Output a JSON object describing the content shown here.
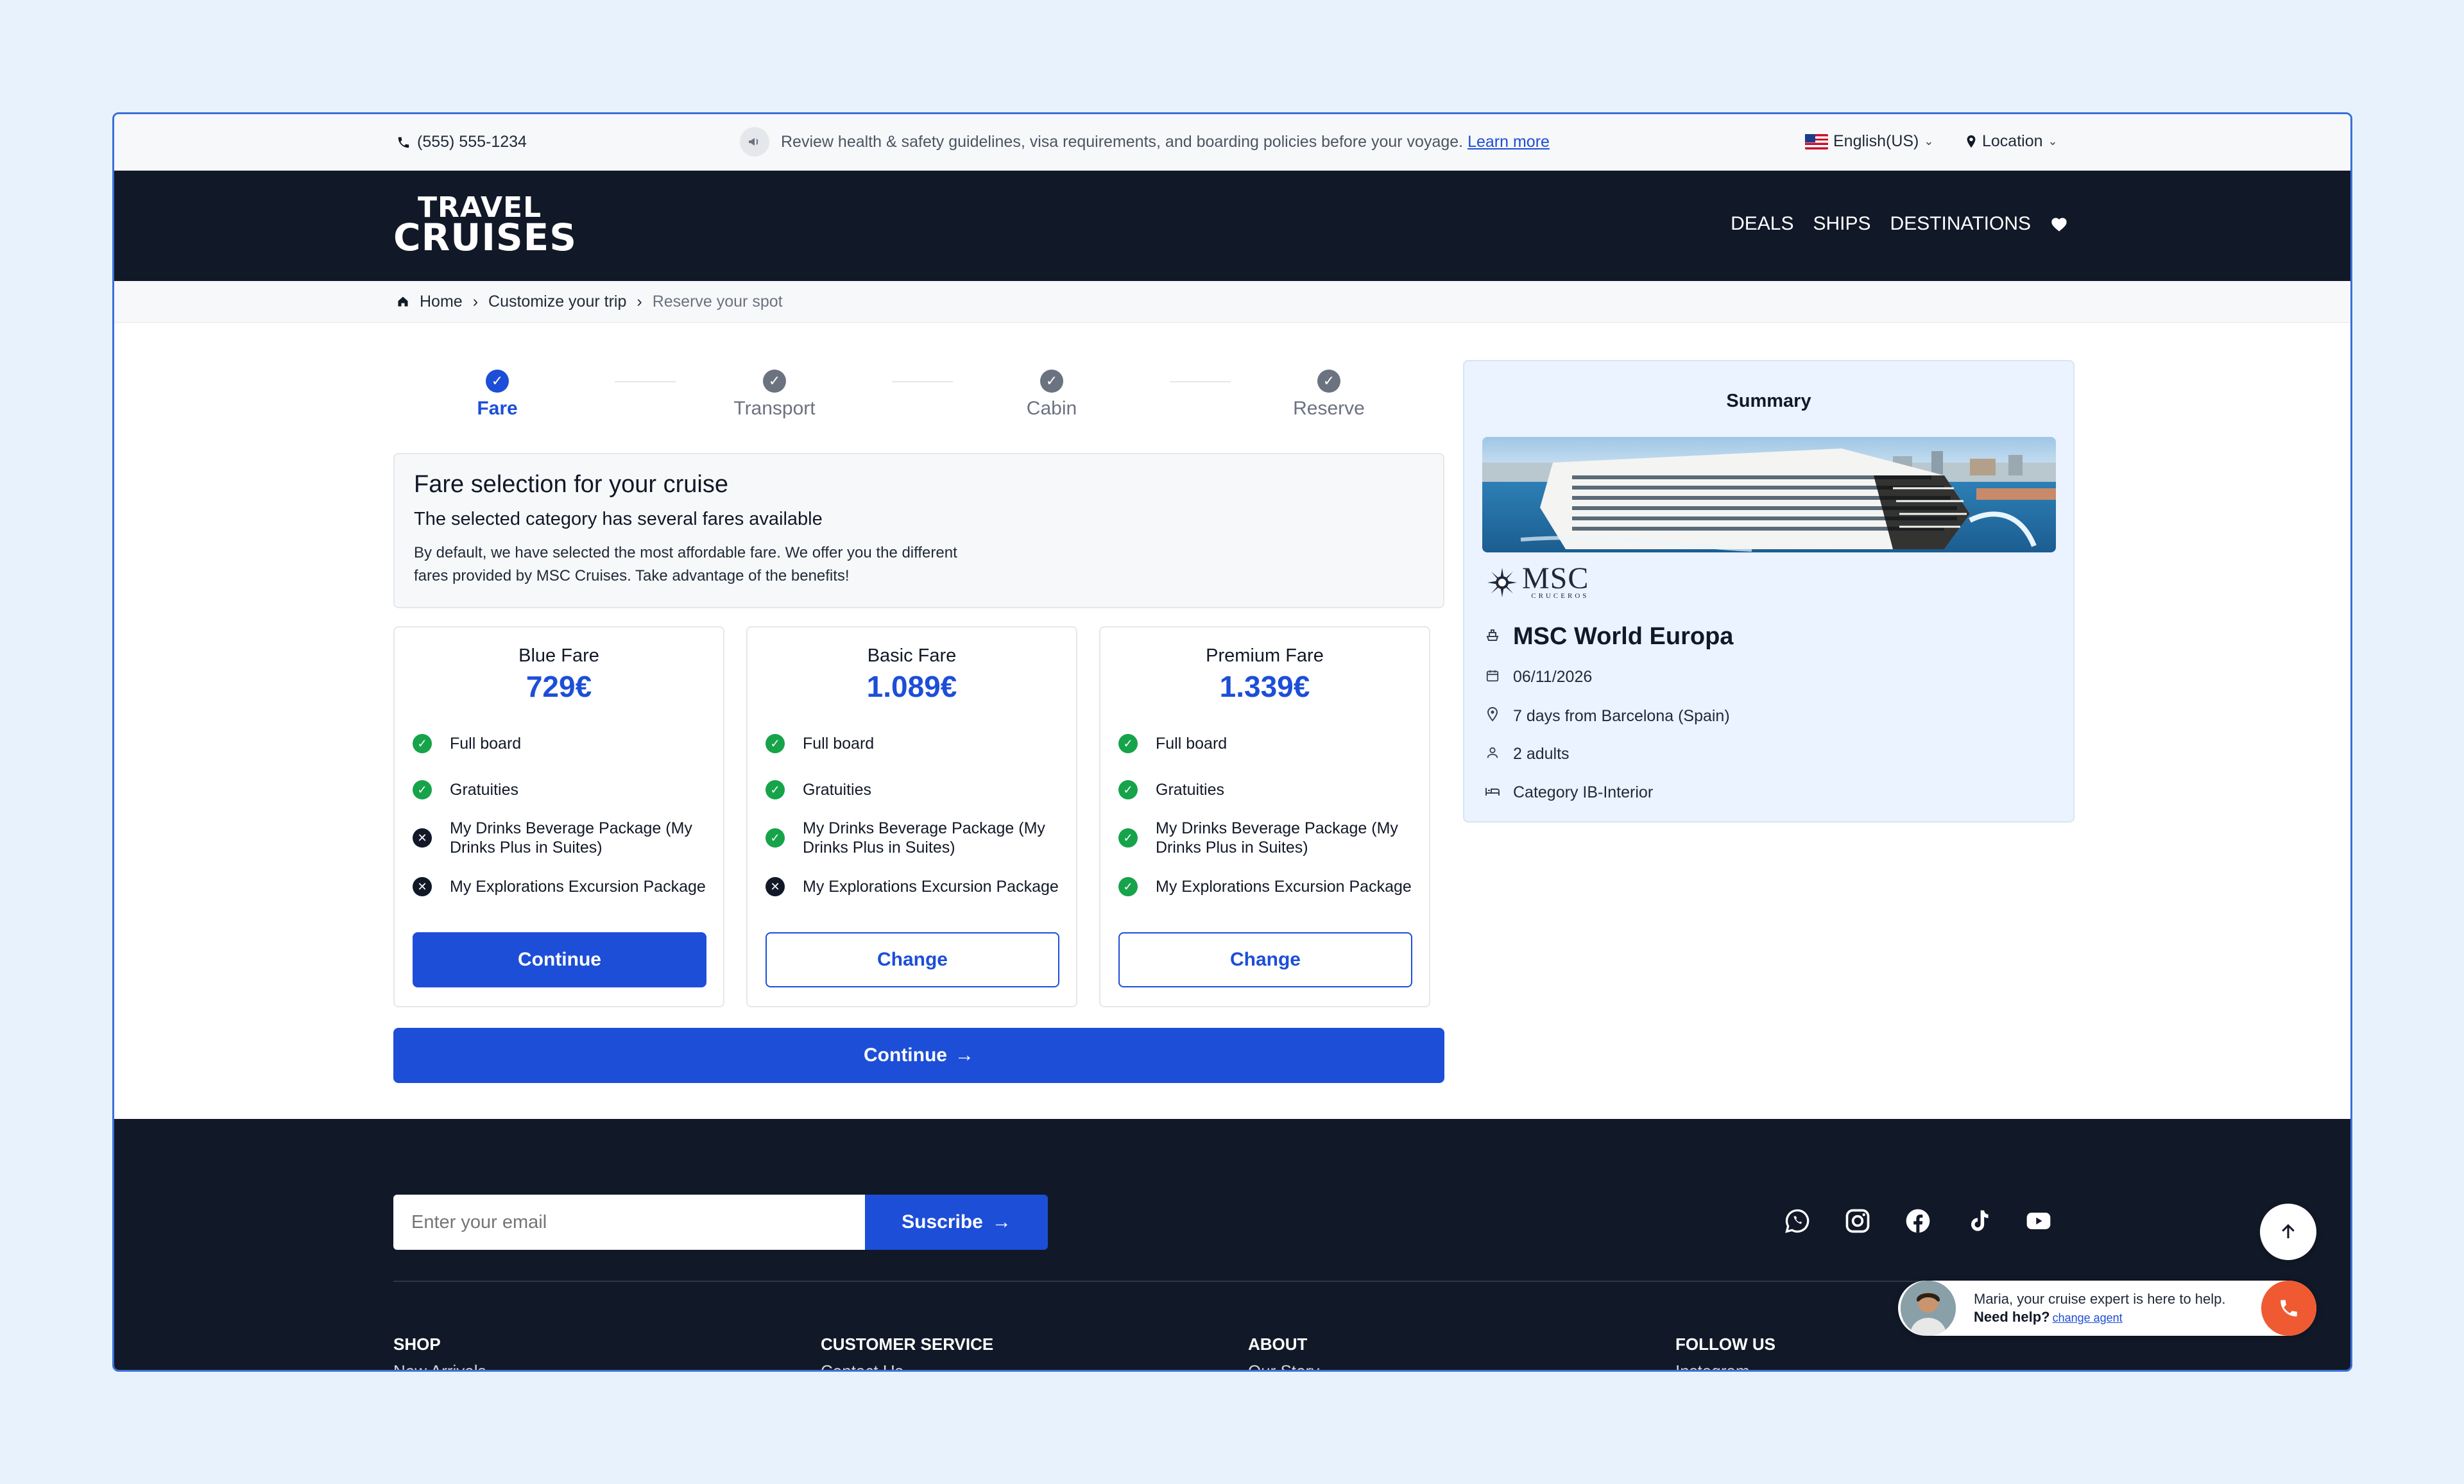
{
  "topbar": {
    "phone": "(555) 555-1234",
    "notice": "Review health & safety guidelines, visa requirements, and boarding policies before your voyage.",
    "learn_more": "Learn more",
    "language": "English(US)",
    "location": "Location"
  },
  "header": {
    "logo_line1": "TRAVEL",
    "logo_line2": "CRUISES",
    "nav": [
      "DEALS",
      "SHIPS",
      "DESTINATIONS"
    ]
  },
  "breadcrumb": [
    "Home",
    "Customize your trip",
    "Reserve your spot"
  ],
  "stepper": {
    "steps": [
      {
        "label": "Fare",
        "state": "active"
      },
      {
        "label": "Transport",
        "state": "todo"
      },
      {
        "label": "Cabin",
        "state": "todo"
      },
      {
        "label": "Reserve",
        "state": "todo"
      }
    ]
  },
  "info": {
    "title": "Fare selection for your cruise",
    "subtitle": "The selected category has several fares available",
    "body": "By default, we have selected the most affordable fare. We offer you the different fares provided by MSC Cruises. Take advantage of the benefits!"
  },
  "fares": [
    {
      "name": "Blue Fare",
      "price": "729€",
      "button": "Continue",
      "features": [
        {
          "text": "Full board",
          "included": true
        },
        {
          "text": "Gratuities",
          "included": true
        },
        {
          "text": "My Drinks Beverage Package (My Drinks Plus in Suites)",
          "included": false
        },
        {
          "text": "My Explorations Excursion Package",
          "included": false
        }
      ]
    },
    {
      "name": "Basic Fare",
      "price": "1.089€",
      "button": "Change",
      "features": [
        {
          "text": "Full board",
          "included": true
        },
        {
          "text": "Gratuities",
          "included": true
        },
        {
          "text": "My Drinks Beverage Package (My Drinks Plus in Suites)",
          "included": true
        },
        {
          "text": "My Explorations Excursion Package",
          "included": false
        }
      ]
    },
    {
      "name": "Premium Fare",
      "price": "1.339€",
      "button": "Change",
      "features": [
        {
          "text": "Full board",
          "included": true
        },
        {
          "text": "Gratuities",
          "included": true
        },
        {
          "text": "My Drinks Beverage Package (My Drinks Plus in Suites)",
          "included": true
        },
        {
          "text": "My Explorations Excursion Package",
          "included": true
        }
      ]
    }
  ],
  "continue_main": "Continue",
  "summary": {
    "title": "Summary",
    "brand": "MSC",
    "brand_sub": "CRUCEROS",
    "ship": "MSC World Europa",
    "date": "06/11/2026",
    "itinerary": "7 days from Barcelona (Spain)",
    "guests": "2 adults",
    "category": "Category IB-Interior"
  },
  "footer": {
    "email_placeholder": "Enter your email",
    "subscribe": "Suscribe",
    "socials": [
      "whatsapp-icon",
      "instagram-icon",
      "facebook-icon",
      "tiktok-icon",
      "youtube-icon"
    ],
    "columns": [
      {
        "title": "SHOP",
        "first": "New Arrivals"
      },
      {
        "title": "CUSTOMER SERVICE",
        "first": "Contact Us"
      },
      {
        "title": "ABOUT",
        "first": "Our Story"
      },
      {
        "title": "FOLLOW US",
        "first": "Instagram"
      }
    ]
  },
  "chat": {
    "line1": "Maria, your cruise expert is here to help.",
    "line2": "Need help?",
    "change": "change agent"
  },
  "colors": {
    "accent": "#1d4ed8",
    "dark": "#111827",
    "success": "#16a34a",
    "call": "#f05a32"
  }
}
